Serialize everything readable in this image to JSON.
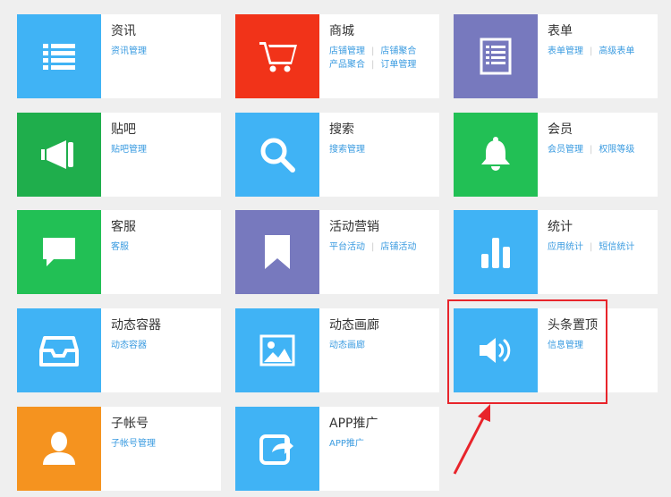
{
  "cards": [
    {
      "id": "news",
      "title": "资讯",
      "color": "#40b3f5",
      "icon": "list-icon",
      "links": [
        "资讯管理"
      ]
    },
    {
      "id": "mall",
      "title": "商城",
      "color": "#f13319",
      "icon": "cart-icon",
      "links": [
        "店铺管理",
        "店铺聚合",
        "产品聚合",
        "订单管理"
      ]
    },
    {
      "id": "form",
      "title": "表单",
      "color": "#7779be",
      "icon": "form-icon",
      "links": [
        "表单管理",
        "高级表单"
      ]
    },
    {
      "id": "forum",
      "title": "贴吧",
      "color": "#1fae4c",
      "icon": "megaphone-icon",
      "links": [
        "贴吧管理"
      ]
    },
    {
      "id": "search",
      "title": "搜索",
      "color": "#40b3f5",
      "icon": "search-icon",
      "links": [
        "搜索管理"
      ]
    },
    {
      "id": "member",
      "title": "会员",
      "color": "#22c055",
      "icon": "bell-icon",
      "links": [
        "会员管理",
        "权限等级"
      ]
    },
    {
      "id": "service",
      "title": "客服",
      "color": "#22c055",
      "icon": "chat-icon",
      "links": [
        "客服"
      ]
    },
    {
      "id": "marketing",
      "title": "活动营销",
      "color": "#7779be",
      "icon": "bookmark-icon",
      "links": [
        "平台活动",
        "店铺活动"
      ]
    },
    {
      "id": "stats",
      "title": "统计",
      "color": "#40b3f5",
      "icon": "bar-chart-icon",
      "links": [
        "应用统计",
        "短信统计"
      ]
    },
    {
      "id": "container",
      "title": "动态容器",
      "color": "#40b3f5",
      "icon": "inbox-icon",
      "links": [
        "动态容器"
      ]
    },
    {
      "id": "gallery",
      "title": "动态画廊",
      "color": "#40b3f5",
      "icon": "image-icon",
      "links": [
        "动态画廊"
      ]
    },
    {
      "id": "headline",
      "title": "头条置顶",
      "color": "#40b3f5",
      "icon": "speaker-icon",
      "links": [
        "信息管理"
      ]
    },
    {
      "id": "subaccount",
      "title": "子帐号",
      "color": "#f5931f",
      "icon": "user-icon",
      "links": [
        "子帐号管理"
      ]
    },
    {
      "id": "app",
      "title": "APP推广",
      "color": "#40b3f5",
      "icon": "share-icon",
      "links": [
        "APP推广"
      ]
    }
  ],
  "annotation": {
    "color": "#e8242b"
  }
}
